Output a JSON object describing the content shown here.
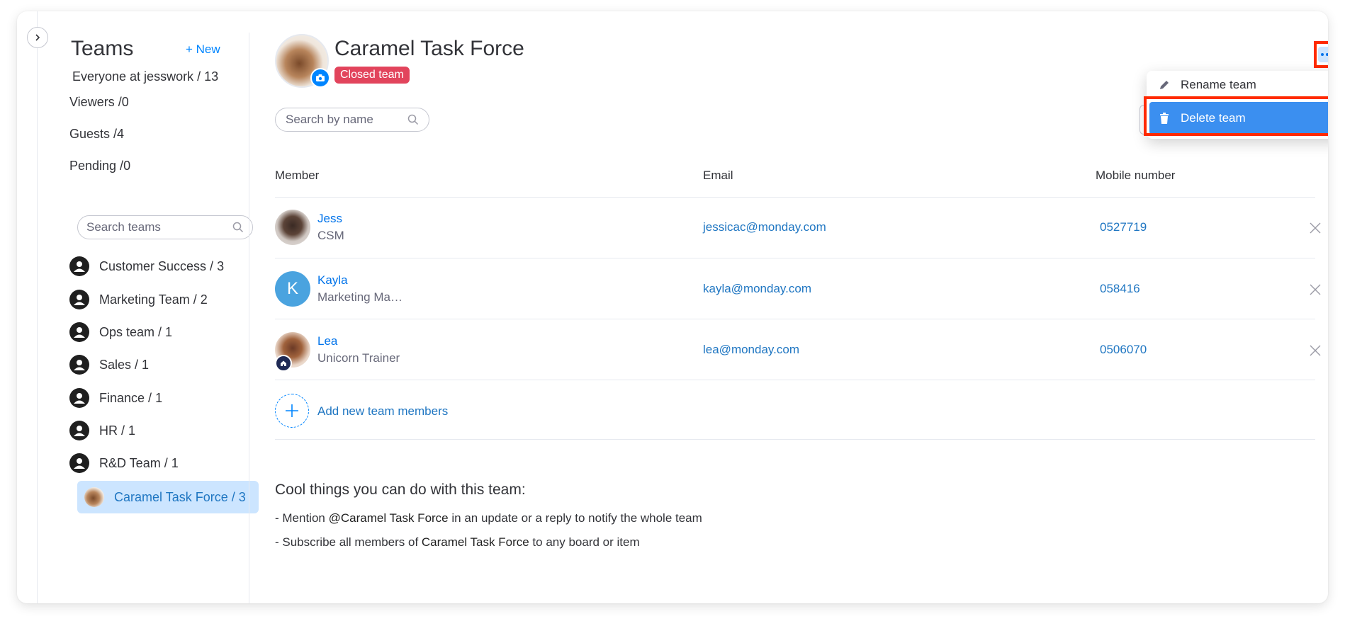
{
  "sidebar": {
    "title": "Teams",
    "new_label": "+ New",
    "counts": [
      {
        "label": "Everyone at jesswork /",
        "count": "13"
      },
      {
        "label": "Viewers /",
        "count": "0"
      },
      {
        "label": "Guests /",
        "count": "4"
      },
      {
        "label": "Pending /",
        "count": "0"
      }
    ],
    "search_placeholder": "Search teams",
    "teams": [
      {
        "label": "Customer Success /",
        "count": "3"
      },
      {
        "label": "Marketing Team /",
        "count": "2"
      },
      {
        "label": "Ops team /",
        "count": "1"
      },
      {
        "label": "Sales /",
        "count": "1"
      },
      {
        "label": "Finance /",
        "count": "1"
      },
      {
        "label": "HR /",
        "count": "1"
      },
      {
        "label": "R&D Team /",
        "count": "1"
      },
      {
        "label": "Caramel Task Force /",
        "count": "3",
        "active": true
      }
    ]
  },
  "team": {
    "name": "Caramel Task Force",
    "badge": "Closed team"
  },
  "search": {
    "placeholder": "Search by name"
  },
  "table": {
    "columns": [
      "Member",
      "Email",
      "Mobile number"
    ],
    "rows": [
      {
        "name": "Jess",
        "role": "CSM",
        "email": "jessicac@monday.com",
        "phone": "0527719"
      },
      {
        "name": "Kayla",
        "role": "Marketing Ma…",
        "email": "kayla@monday.com",
        "phone": "058416",
        "initial": "K"
      },
      {
        "name": "Lea",
        "role": "Unicorn Trainer",
        "email": "lea@monday.com",
        "phone": "0506070"
      }
    ]
  },
  "add_member_label": "Add new team members",
  "cool": {
    "title": "Cool things you can do with this team:",
    "line1_pre": "- Mention ",
    "line1_bold": "@Caramel Task Force",
    "line1_post": " in an update or a reply to notify the whole team",
    "line2_pre": "- Subscribe all members of ",
    "line2_bold": "Caramel Task Force",
    "line2_post": " to any board or item"
  },
  "menu": {
    "rename": "Rename team",
    "delete": "Delete team"
  },
  "colors": {
    "accent": "#0085ff",
    "closed_badge": "#e2445c",
    "highlight": "#ff2a00",
    "menu_active": "#3b8ff0"
  }
}
